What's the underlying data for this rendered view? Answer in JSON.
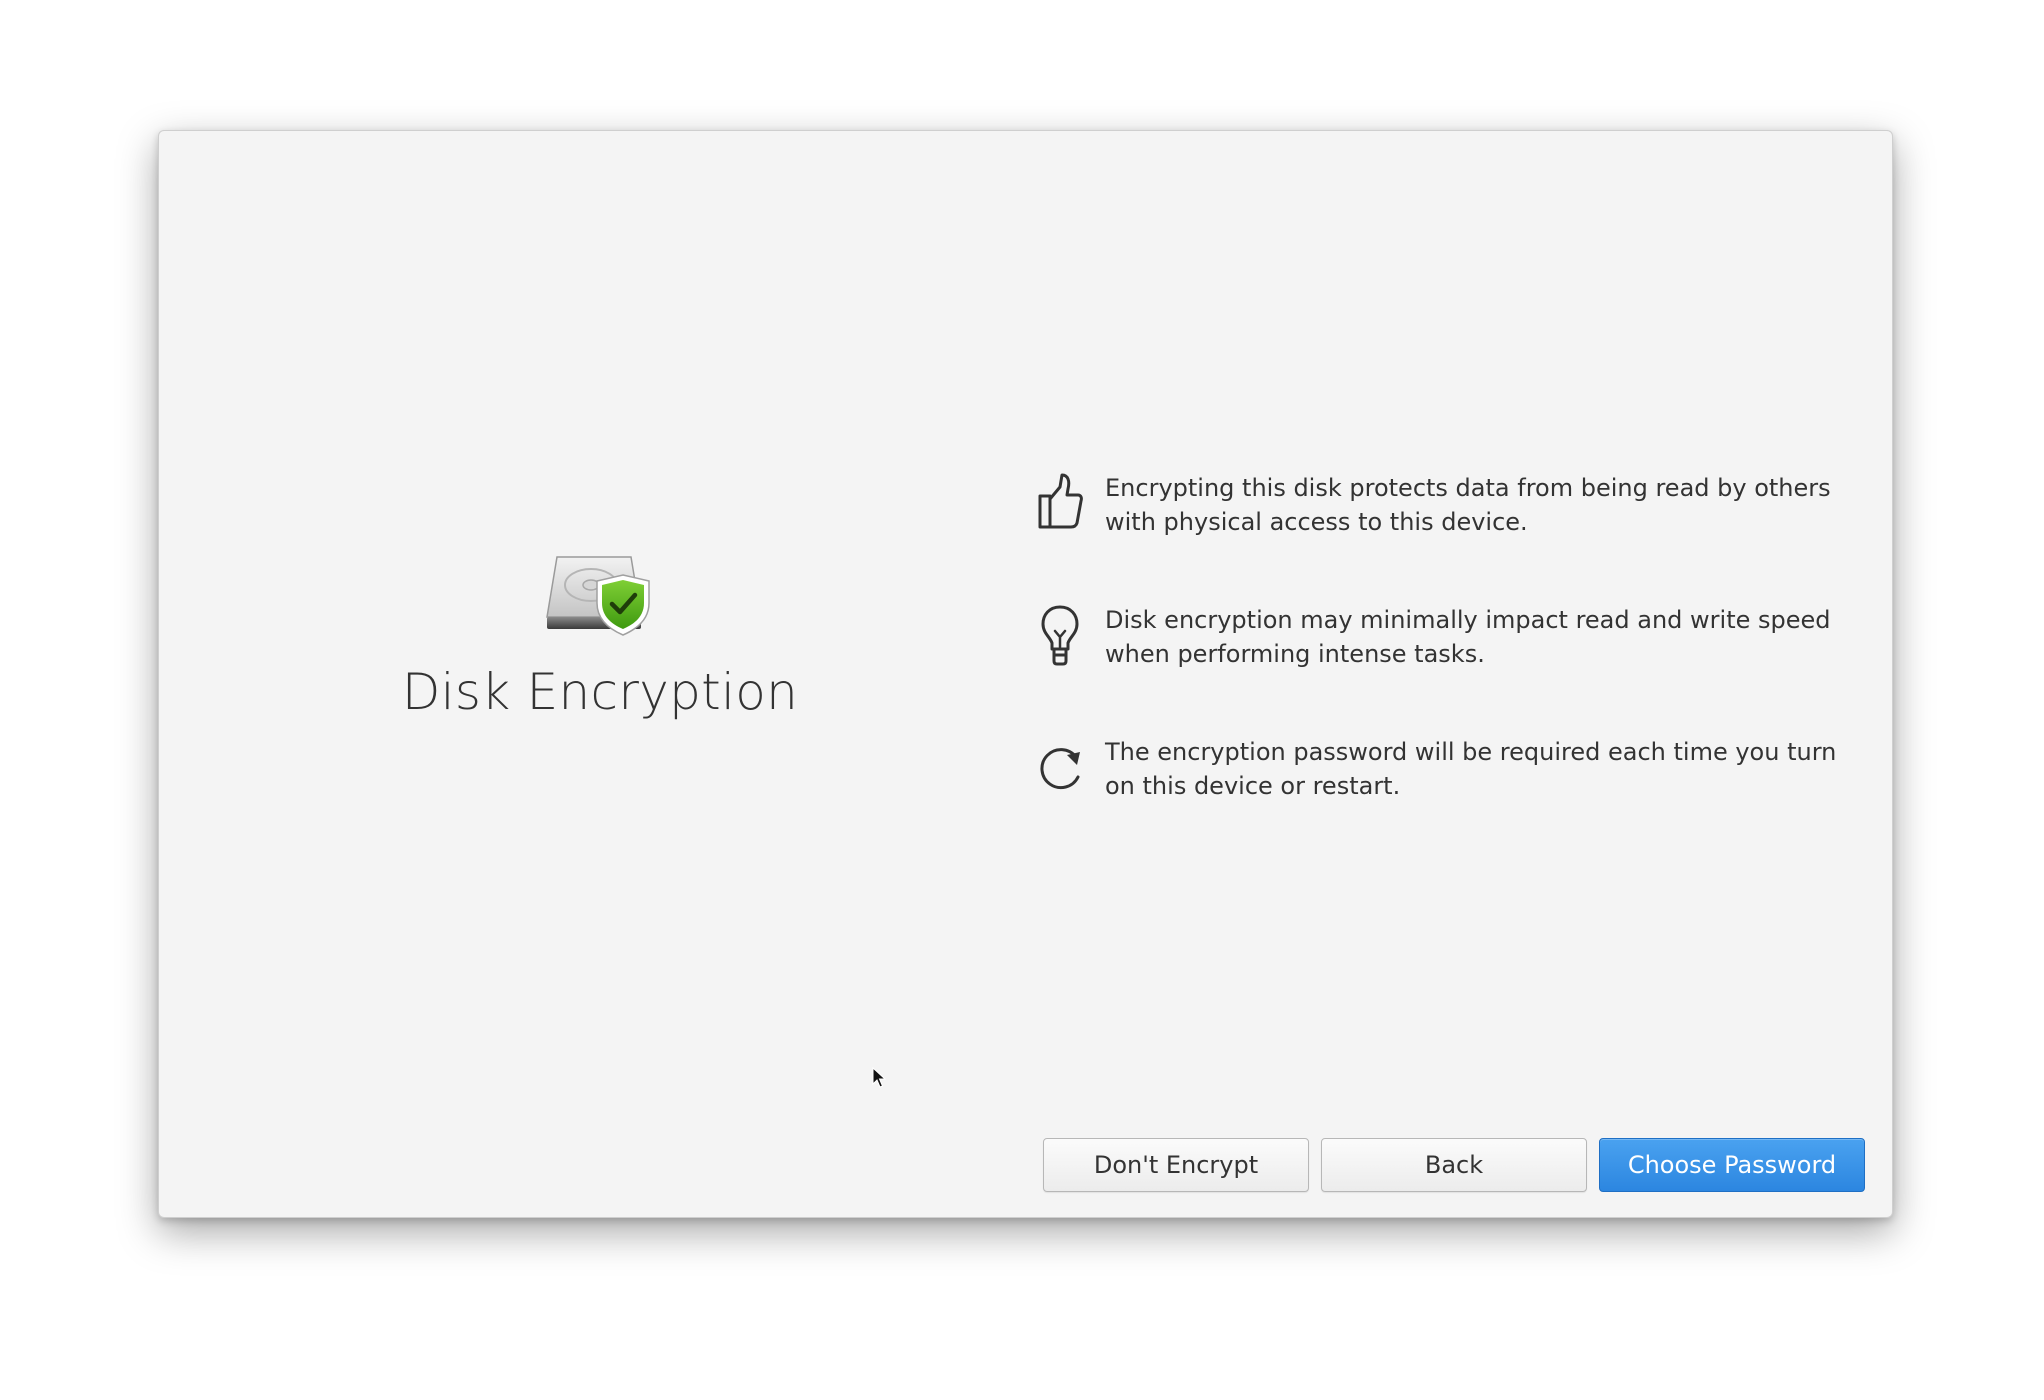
{
  "dialog": {
    "title": "Disk Encryption",
    "hero_icon": "drive-harddisk-shield-icon"
  },
  "features": [
    {
      "icon": "thumbs-up-icon",
      "text": "Encrypting this disk protects data from being read by others with physical access to this device."
    },
    {
      "icon": "lightbulb-icon",
      "text": "Disk encryption may minimally impact read and write speed when performing intense tasks."
    },
    {
      "icon": "refresh-icon",
      "text": "The encryption password will be required each time you turn on this device or restart."
    }
  ],
  "buttons": {
    "dont_encrypt": "Don't Encrypt",
    "back": "Back",
    "choose_password": "Choose Password"
  },
  "colors": {
    "window_bg": "#f4f4f4",
    "accent": "#3689e6",
    "shield_green": "#68b723",
    "text": "#333333"
  }
}
